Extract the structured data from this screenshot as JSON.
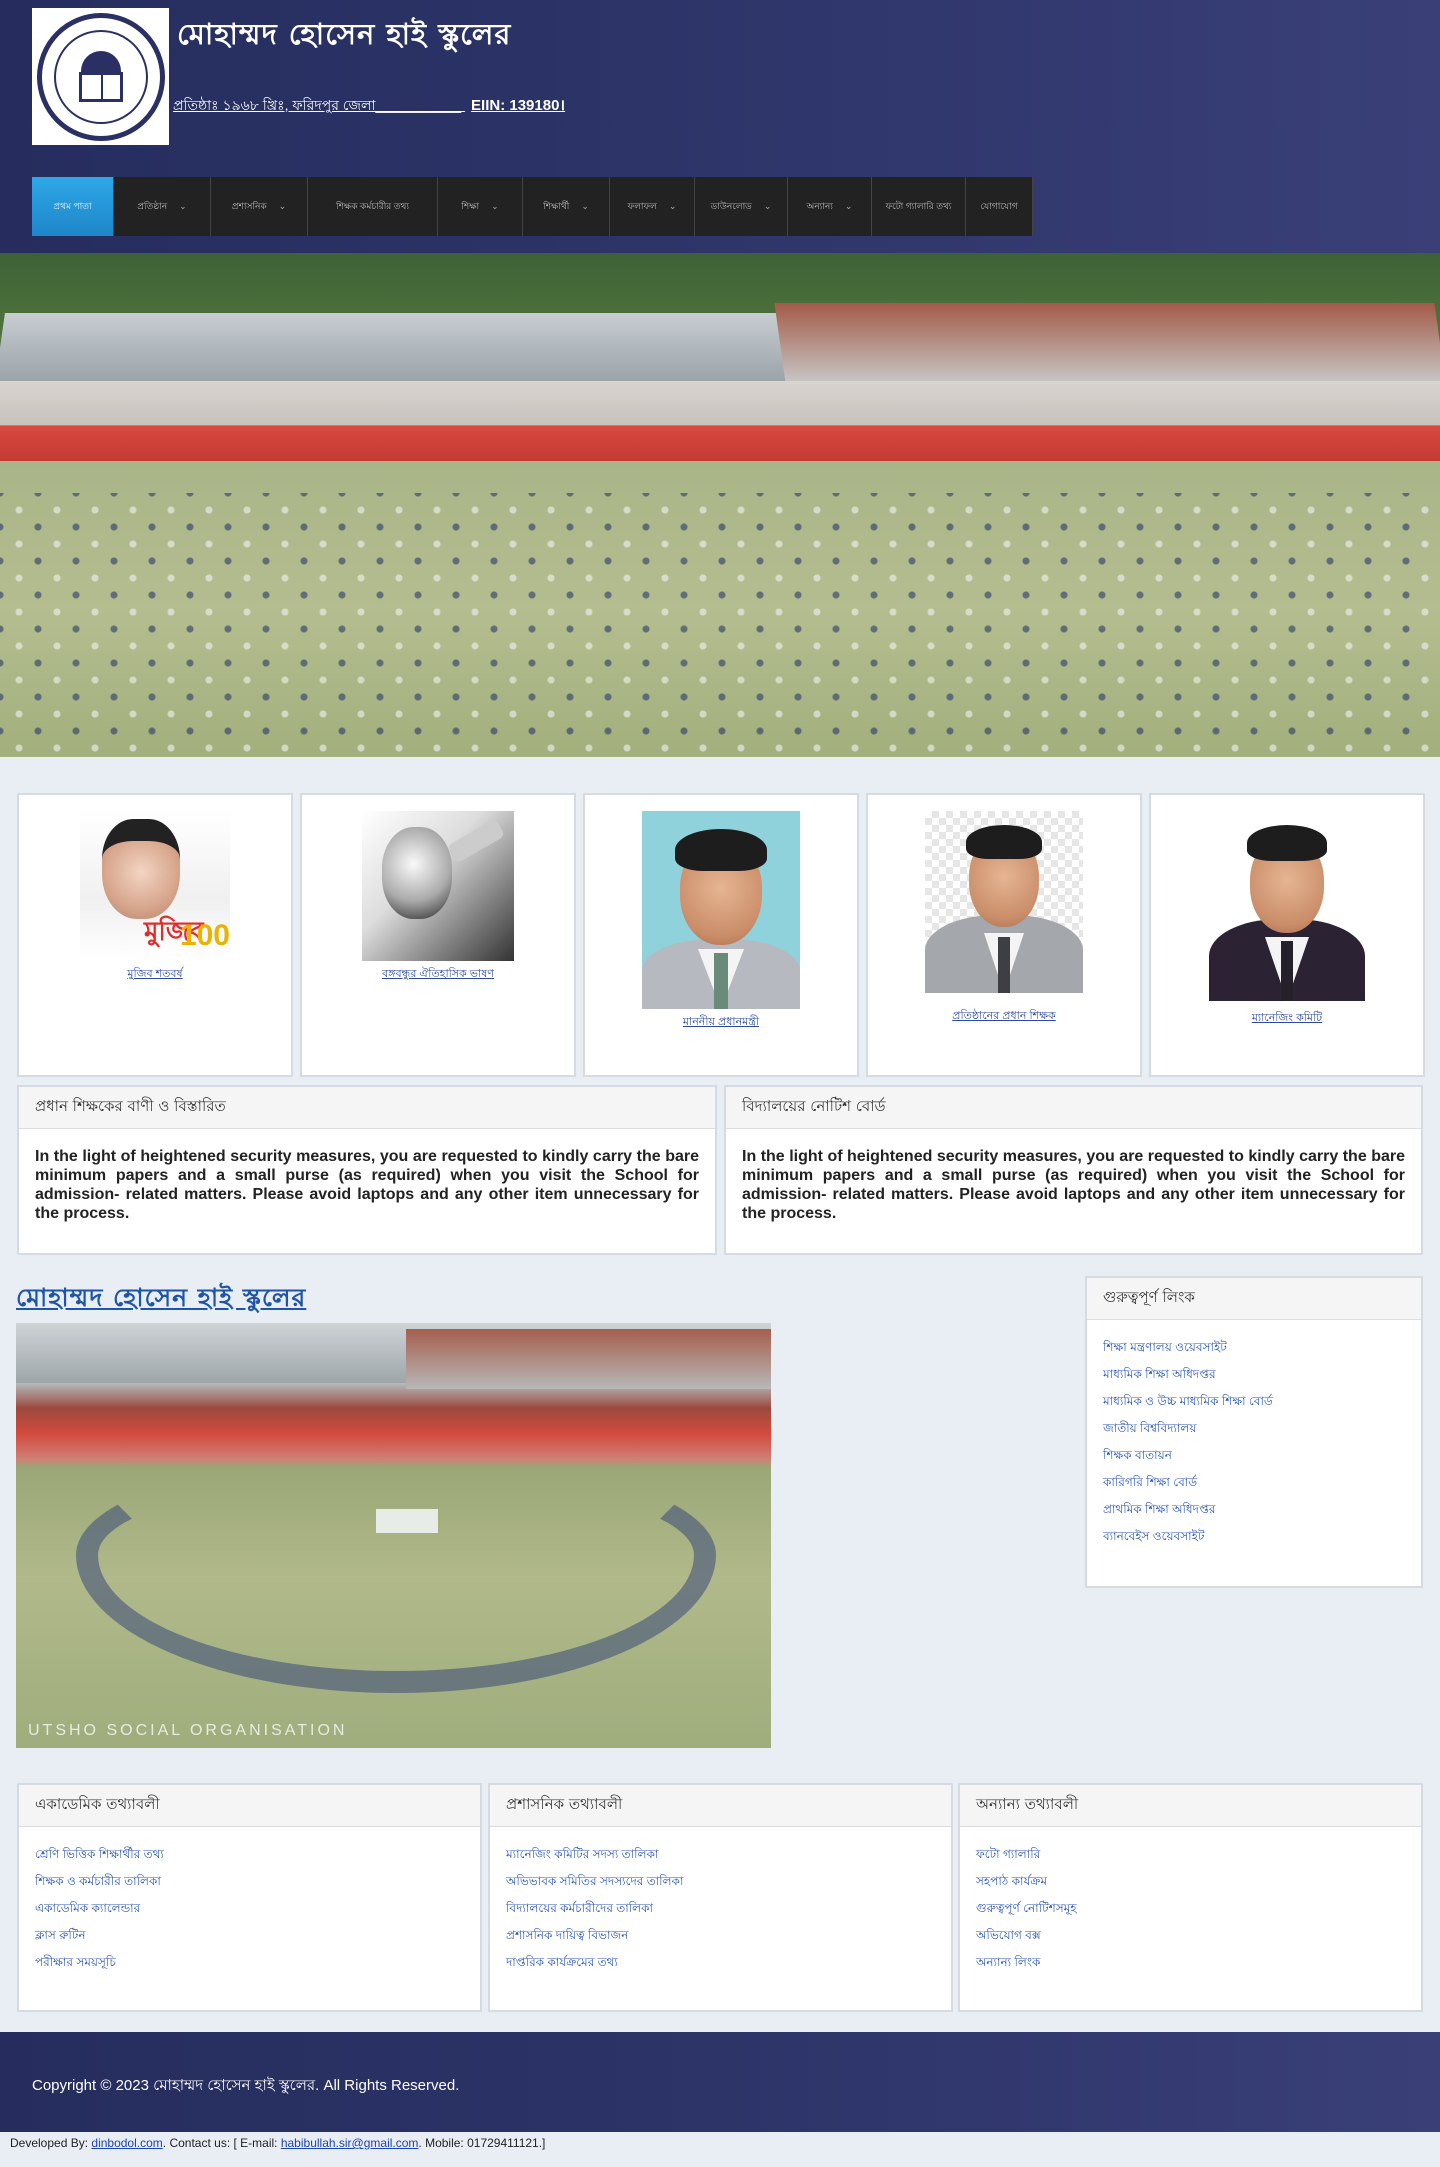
{
  "header": {
    "title": "মোহাম্মদ হোসেন হাই স্কুলের",
    "subtitle": "প্রতিষ্ঠাঃ ১৯৬৮ খ্রিঃ, ফরিদপুর জেলা___________",
    "eiin": "EIIN: 139180।"
  },
  "nav": {
    "items": [
      {
        "label": "প্রথম পাতা",
        "has_caret": false,
        "active": true
      },
      {
        "label": "প্রতিষ্ঠান",
        "has_caret": true
      },
      {
        "label": "প্রশাসনিক",
        "has_caret": true
      },
      {
        "label": "শিক্ষক কর্মচারীর তথ্য",
        "has_caret": true
      },
      {
        "label": "শিক্ষা",
        "has_caret": true
      },
      {
        "label": "শিক্ষার্থী",
        "has_caret": true
      },
      {
        "label": "ফলাফল",
        "has_caret": true
      },
      {
        "label": "ডাউনলোড",
        "has_caret": true
      },
      {
        "label": "অন্যান্য",
        "has_caret": true
      },
      {
        "label": "ফটো গ্যালারি তথ্য",
        "has_caret": false
      },
      {
        "label": "যোগাযোগ",
        "has_caret": false
      }
    ]
  },
  "cards": [
    {
      "name": "মুজিব শতবর্ষ"
    },
    {
      "name": "বঙ্গবন্ধুর ঐতিহাসিক ভাষণ"
    },
    {
      "name": "মাননীয় প্রধানমন্ত্রী"
    },
    {
      "name": "প্রতিষ্ঠানের প্রধান শিক্ষক"
    },
    {
      "name": "ম্যানেজিং কমিটি"
    }
  ],
  "card_images": {
    "mujib_logo_text": "মুজিব",
    "mujib_hundred": "100",
    "mujib_small": "শতবর্ষ"
  },
  "notices": [
    {
      "title": "প্রধান শিক্ষকের বাণী ও বিস্তারিত",
      "body": "In the light of heightened security measures, you are requested to kindly carry the bare minimum papers and a small purse (as required) when you visit the School for admission- related matters. Please avoid laptops and any other item unnecessary for the process."
    },
    {
      "title": "বিদ্যালয়ের নোটিশ বোর্ড",
      "body": "In the light of heightened security measures, you are requested to kindly carry the bare minimum papers and a small purse (as required) when you visit the School for admission- related matters. Please avoid laptops and any other item unnecessary for the process."
    }
  ],
  "main": {
    "title": "মোহাম্মদ হোসেন হাই স্কুলের",
    "photo_watermark": "UTSHO SOCIAL ORGANISATION"
  },
  "sidebar": {
    "title": "গুরুত্বপূর্ণ লিংক",
    "links": [
      "শিক্ষা মন্ত্রণালয় ওয়েবসাইট",
      "মাধ্যমিক শিক্ষা অধিদপ্তর",
      "মাধ্যমিক ও উচ্চ মাধ্যমিক শিক্ষা বোর্ড",
      "জাতীয় বিশ্ববিদ্যালয়",
      "শিক্ষক বাতায়ন",
      "কারিগরি শিক্ষা বোর্ড",
      "প্রাথমিক শিক্ষা অধিদপ্তর",
      "ব্যানবেইস ওয়েবসাইট"
    ]
  },
  "bottom": [
    {
      "title": "একাডেমিক তথ্যাবলী",
      "links": [
        "শ্রেণি ভিত্তিক শিক্ষার্থীর তথ্য",
        "শিক্ষক ও কর্মচারীর তালিকা",
        "একাডেমিক ক্যালেন্ডার",
        "ক্লাস রুটিন",
        "পরীক্ষার সময়সূচি"
      ]
    },
    {
      "title": "প্রশাসনিক তথ্যাবলী",
      "links": [
        "ম্যানেজিং কমিটির সদস্য তালিকা",
        "অভিভাবক সমিতির সদস্যদের তালিকা",
        "বিদ্যালয়ের কর্মচারীদের তালিকা",
        "প্রশাসনিক দায়িত্ব বিভাজন",
        "দাপ্তরিক কার্যক্রমের তথ্য"
      ]
    },
    {
      "title": "অন্যান্য তথ্যাবলী",
      "links": [
        "ফটো গ্যালারি",
        "সহপাঠ কার্যক্রম",
        "গুরুত্বপূর্ণ নোটিশসমূহ",
        "অভিযোগ বক্স",
        "অন্যান্য লিংক"
      ]
    }
  ],
  "footer": {
    "copyright": "Copyright © 2023 মোহাম্মদ হোসেন হাই স্কুলের. All Rights Reserved."
  },
  "devline": {
    "prefix": "Developed By: ",
    "dev_link": "dinbodol.com",
    "contact_prefix": ". Contact us: [ E-mail: ",
    "email": "habibullah.sir@gmail.com",
    "mobile": ". Mobile: 01729411121.]"
  },
  "colors": {
    "header_bg": "#2c3468",
    "nav_bg": "#222222",
    "nav_active": "#2ea8e8",
    "link": "#2a56b5"
  }
}
